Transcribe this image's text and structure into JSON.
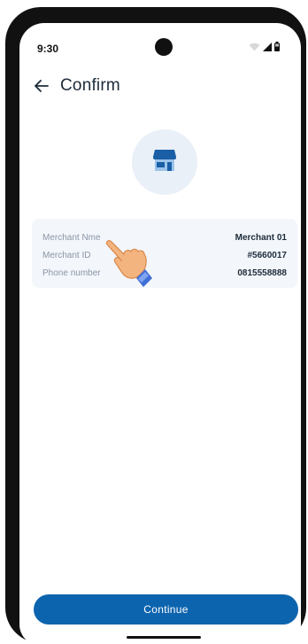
{
  "status_bar": {
    "time": "9:30",
    "icons": [
      "wifi-icon",
      "signal-icon",
      "battery-icon"
    ]
  },
  "header": {
    "back_icon": "arrow-left-icon",
    "title": "Confirm"
  },
  "merchant_icon": "store-icon",
  "merchant_info": {
    "rows": [
      {
        "label": "Merchant Nme",
        "value": "Merchant 01"
      },
      {
        "label": "Merchant ID",
        "value": "#5660017"
      },
      {
        "label": "Phone number",
        "value": "0815558888"
      }
    ]
  },
  "pointer_icon": "hand-pointer-icon",
  "footer": {
    "continue_label": "Continue"
  },
  "colors": {
    "primary": "#0d64ae",
    "card_background": "#f3f6fb",
    "icon_circle": "#eaf0f7",
    "title_text": "#1c2b3a",
    "label_text": "#8a95a5"
  }
}
